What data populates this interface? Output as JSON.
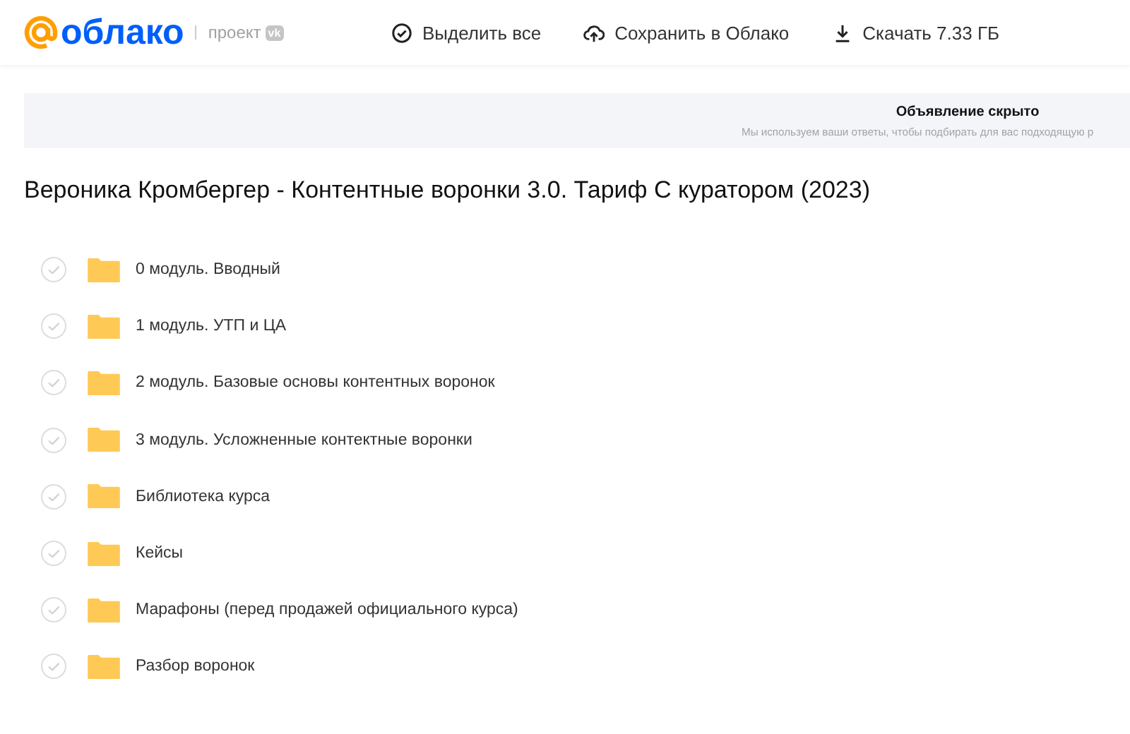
{
  "header": {
    "logo": "облако",
    "project": "проект",
    "badge": "vk",
    "actions": [
      {
        "kind": "select",
        "label": "Выделить все"
      },
      {
        "kind": "upload",
        "label": "Сохранить в Облако"
      },
      {
        "kind": "download",
        "label": "Скачать 7.33 ГБ"
      }
    ]
  },
  "ad": {
    "title": "Объявление скрыто",
    "text": "Мы используем ваши ответы, чтобы подбирать для вас подходящую р"
  },
  "title": "Вероника Кромбергер - Контентные воронки 3.0. Тариф С куратором (2023)",
  "items": [
    {
      "name": "0 модуль. Вводный",
      "checked": false
    },
    {
      "name": "1 модуль. УТП и ЦА",
      "checked": false
    },
    {
      "name": "2 модуль. Базовые основы контентных воронок",
      "checked": false
    },
    {
      "name": "3 модуль. Усложненные контектные воронки",
      "checked": false
    },
    {
      "name": "Библиотека курса",
      "checked": false
    },
    {
      "name": "Кейсы",
      "checked": false
    },
    {
      "name": "Марафоны (перед продажей официального курса)",
      "checked": false
    },
    {
      "name": "Разбор воронок",
      "checked": false
    }
  ]
}
